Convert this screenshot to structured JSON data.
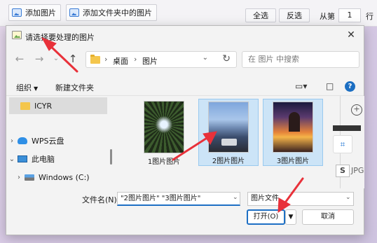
{
  "app": {
    "add_image_label": "添加图片",
    "add_folder_images_label": "添加文件夹中的图片",
    "select_all_label": "全选",
    "invert_select_label": "反选",
    "from_label": "从第",
    "from_value": "1",
    "row_label": "行"
  },
  "dialog": {
    "title": "请选择要处理的图片",
    "close_glyph": "✕",
    "breadcrumb": [
      "桌面",
      "图片"
    ],
    "breadcrumb_sep": "›",
    "search_placeholder": "在 图片 中搜索",
    "organize_label": "组织",
    "new_folder_label": "新建文件夹",
    "help_glyph": "?",
    "nav_items": [
      {
        "label": "ICYR",
        "chevron": ""
      },
      {
        "label": "WPS云盘",
        "chevron": "›"
      },
      {
        "label": "此电脑",
        "chevron": "⌄"
      },
      {
        "label": "Windows (C:)",
        "chevron": "›"
      }
    ],
    "files": [
      {
        "label": "1图片图片",
        "selected": false
      },
      {
        "label": "2图片图片",
        "selected": true
      },
      {
        "label": "3图片图片",
        "selected": true
      }
    ],
    "preview_text": "JPG",
    "preview_badge": "S",
    "filename_label": "文件名(N):",
    "filename_value": "\"2图片图片\" \"3图片图片\"",
    "filetype_value": "图片文件",
    "open_label": "打开(O)",
    "cancel_label": "取消"
  },
  "colors": {
    "accent": "#1d6fc4",
    "selection": "#cce4f7",
    "annotation": "#e8313a"
  }
}
